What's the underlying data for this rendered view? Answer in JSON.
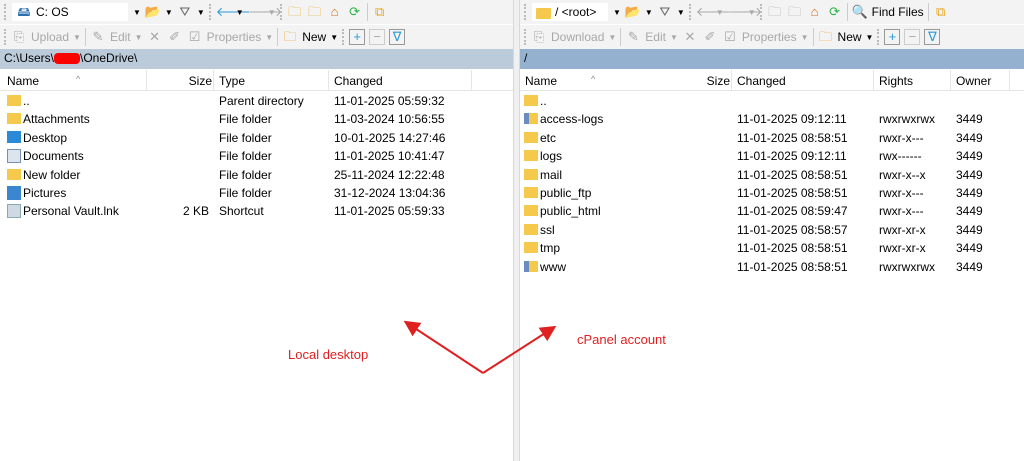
{
  "left": {
    "drive": "C: OS",
    "toolbar2": {
      "upload": "Upload",
      "edit": "Edit",
      "properties": "Properties",
      "new": "New"
    },
    "path_prefix": "C:\\Users\\",
    "path_suffix": "\\OneDrive\\",
    "columns": {
      "name": "Name",
      "size": "Size",
      "type": "Type",
      "changed": "Changed"
    },
    "files": [
      {
        "name": "..",
        "size": "",
        "type": "Parent directory",
        "changed": "11-01-2025 05:59:32",
        "icon": "parent-folder"
      },
      {
        "name": "Attachments",
        "size": "",
        "type": "File folder",
        "changed": "11-03-2024 10:56:55",
        "icon": "folder"
      },
      {
        "name": "Desktop",
        "size": "",
        "type": "File folder",
        "changed": "10-01-2025 14:27:46",
        "icon": "desktop"
      },
      {
        "name": "Documents",
        "size": "",
        "type": "File folder",
        "changed": "11-01-2025 10:41:47",
        "icon": "documents"
      },
      {
        "name": "New folder",
        "size": "",
        "type": "File folder",
        "changed": "25-11-2024 12:22:48",
        "icon": "folder"
      },
      {
        "name": "Pictures",
        "size": "",
        "type": "File folder",
        "changed": "31-12-2024 13:04:36",
        "icon": "pictures"
      },
      {
        "name": "Personal Vault.lnk",
        "size": "2 KB",
        "type": "Shortcut",
        "changed": "11-01-2025 05:59:33",
        "icon": "shortcut"
      }
    ]
  },
  "right": {
    "drive": "/ <root>",
    "find_files": "Find Files",
    "toolbar2": {
      "download": "Download",
      "edit": "Edit",
      "properties": "Properties",
      "new": "New"
    },
    "path": "/",
    "columns": {
      "name": "Name",
      "size": "Size",
      "changed": "Changed",
      "rights": "Rights",
      "owner": "Owner"
    },
    "files": [
      {
        "name": "..",
        "changed": "",
        "rights": "",
        "owner": "",
        "icon": "parent-folder"
      },
      {
        "name": "access-logs",
        "changed": "11-01-2025 09:12:11",
        "rights": "rwxrwxrwx",
        "owner": "3449",
        "icon": "link"
      },
      {
        "name": "etc",
        "changed": "11-01-2025 08:58:51",
        "rights": "rwxr-x---",
        "owner": "3449",
        "icon": "folder"
      },
      {
        "name": "logs",
        "changed": "11-01-2025 09:12:11",
        "rights": "rwx------",
        "owner": "3449",
        "icon": "folder"
      },
      {
        "name": "mail",
        "changed": "11-01-2025 08:58:51",
        "rights": "rwxr-x--x",
        "owner": "3449",
        "icon": "folder"
      },
      {
        "name": "public_ftp",
        "changed": "11-01-2025 08:58:51",
        "rights": "rwxr-x---",
        "owner": "3449",
        "icon": "folder"
      },
      {
        "name": "public_html",
        "changed": "11-01-2025 08:59:47",
        "rights": "rwxr-x---",
        "owner": "3449",
        "icon": "folder"
      },
      {
        "name": "ssl",
        "changed": "11-01-2025 08:58:57",
        "rights": "rwxr-xr-x",
        "owner": "3449",
        "icon": "folder"
      },
      {
        "name": "tmp",
        "changed": "11-01-2025 08:58:51",
        "rights": "rwxr-xr-x",
        "owner": "3449",
        "icon": "folder"
      },
      {
        "name": "www",
        "changed": "11-01-2025 08:58:51",
        "rights": "rwxrwxrwx",
        "owner": "3449",
        "icon": "link"
      }
    ]
  },
  "annotations": {
    "local": "Local desktop",
    "remote": "cPanel account",
    "color": "#e02020"
  }
}
